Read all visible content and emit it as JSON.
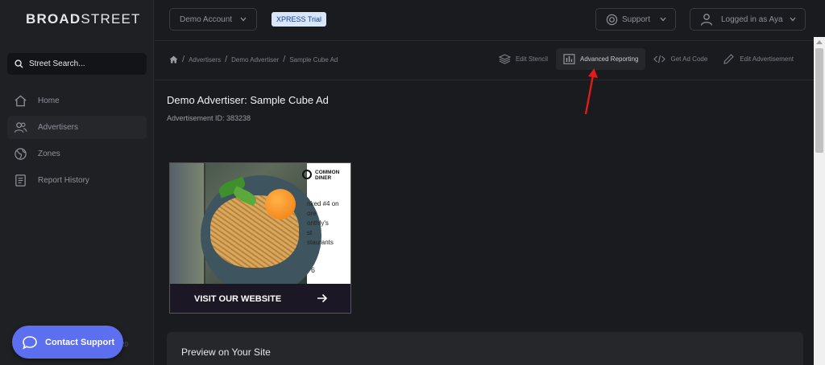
{
  "app": {
    "logo_bold": "BROAD",
    "logo_thin": "STREET"
  },
  "sidebar": {
    "search_placeholder": "Street Search...",
    "items": [
      {
        "label": "Home",
        "icon": "home-icon"
      },
      {
        "label": "Advertisers",
        "icon": "users-icon",
        "active": true
      },
      {
        "label": "Zones",
        "icon": "globe-icon"
      },
      {
        "label": "Report History",
        "icon": "report-icon"
      }
    ],
    "contact_label": "Contact Support",
    "footer_fragment": "20"
  },
  "topbar": {
    "account_label": "Demo Account",
    "trial_badge": "XPRESS Trial",
    "support_label": "Support",
    "user_label": "Logged in as Aya"
  },
  "breadcrumb": {
    "items": [
      "Advertisers",
      "Demo Advertiser",
      "Sample Cube Ad"
    ]
  },
  "toolbar": {
    "edit_stencil": "Edit Stencil",
    "advanced_reporting": "Advanced Reporting",
    "get_ad_code": "Get Ad Code",
    "edit_advertisement": "Edit Advertisement"
  },
  "main": {
    "title": "Demo Advertiser: Sample Cube Ad",
    "ad_id": "Advertisement ID: 383238"
  },
  "ad_preview": {
    "brand_line1": "COMMON",
    "brand_line2": "DINER",
    "copy": "nked #4 on\nore\nonthly's\nst\nstaurants",
    "number_fragment": "6",
    "cta_label": "VISIT OUR WEBSITE"
  },
  "preview_section": {
    "title": "Preview on Your Site"
  },
  "colors": {
    "accent": "#5b6ff0",
    "annotation": "#e01b1b",
    "trial_badge_bg": "#d9e6fa"
  }
}
